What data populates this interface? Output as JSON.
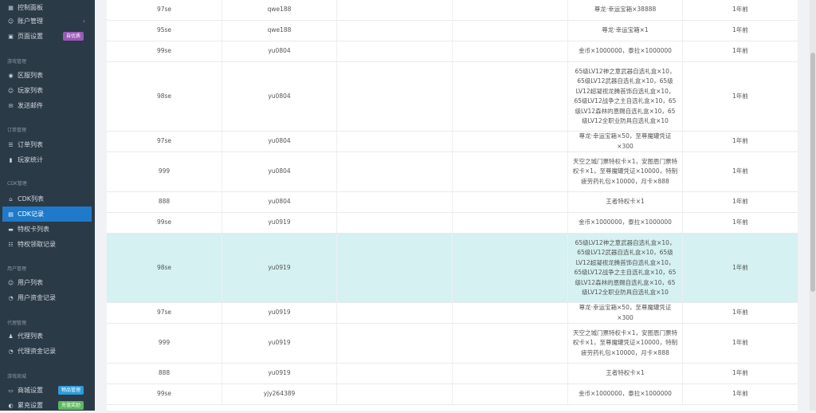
{
  "sidebar": {
    "items": [
      {
        "label": "控制面板",
        "icon": "dashboard-icon"
      },
      {
        "label": "账户管理",
        "icon": "user-settings-icon"
      },
      {
        "label": "页面设置",
        "icon": "page-settings-icon",
        "badge": "自优质",
        "badge_color": "#9b59b6"
      }
    ],
    "sections": [
      {
        "title": "游戏管理",
        "items": [
          {
            "label": "区服列表",
            "icon": "server-icon"
          },
          {
            "label": "玩家列表",
            "icon": "players-icon"
          },
          {
            "label": "发送邮件",
            "icon": "mail-icon"
          }
        ]
      },
      {
        "title": "订单管理",
        "items": [
          {
            "label": "订单列表",
            "icon": "order-list-icon"
          },
          {
            "label": "玩家统计",
            "icon": "bar-chart-icon"
          }
        ]
      },
      {
        "title": "CDK管理",
        "items": [
          {
            "label": "CDK列表",
            "icon": "cdk-list-icon"
          },
          {
            "label": "CDK记录",
            "icon": "cdk-record-icon",
            "active": true
          },
          {
            "label": "特权卡列表",
            "icon": "card-icon"
          },
          {
            "label": "特权领取记录",
            "icon": "record-icon"
          }
        ]
      },
      {
        "title": "用户管理",
        "items": [
          {
            "label": "用户列表",
            "icon": "user-list-icon"
          },
          {
            "label": "用户资金记录",
            "icon": "funds-icon"
          }
        ]
      },
      {
        "title": "代理管理",
        "items": [
          {
            "label": "代理列表",
            "icon": "agent-icon"
          },
          {
            "label": "代理资金记录",
            "icon": "agent-funds-icon"
          }
        ]
      },
      {
        "title": "游戏商城",
        "items": [
          {
            "label": "商城设置",
            "icon": "shop-icon",
            "badge": "物品管理",
            "badge_color": "#2d9cdb"
          },
          {
            "label": "累充设置",
            "icon": "recharge-icon",
            "badge": "充值奖励",
            "badge_color": "#5cb85c"
          }
        ]
      }
    ]
  },
  "table": {
    "rows": [
      {
        "server": "97se",
        "user": "qwe188",
        "c3": "",
        "c4": "",
        "reward": "尊龙·幸运宝箱×38888",
        "time": "1年前"
      },
      {
        "server": "95se",
        "user": "qwe188",
        "c3": "",
        "c4": "",
        "reward": "尊龙·幸运宝箱×1",
        "time": "1年前"
      },
      {
        "server": "99se",
        "user": "yu0804",
        "c3": "",
        "c4": "",
        "reward": "金币×1000000，泰拉×1000000",
        "time": "1年前"
      },
      {
        "server": "98se",
        "user": "yu0804",
        "c3": "",
        "c4": "",
        "reward": "65级LV12神之意武器自选礼盒×10，65级LV12武器自选礼盒×10，65级LV12超凝视龙腾首饰自选礼盒×10，65级LV12战争之主自选礼盒×10，65级LV12森林的恩赐自选礼盒×10，65级LV12全职业防具自选礼盒×10",
        "time": "1年前"
      },
      {
        "server": "97se",
        "user": "yu0804",
        "c3": "",
        "c4": "",
        "reward": "尊龙·幸运宝箱×50，至尊魔罐凭证×300",
        "time": "1年前"
      },
      {
        "server": "999",
        "user": "yu0804",
        "c3": "",
        "c4": "",
        "reward": "天空之城门票特权卡×1，安图恩门票特权卡×1，至尊魔罐凭证×10000，特制疲劳药礼包×10000，月卡×888",
        "time": "1年前"
      },
      {
        "server": "888",
        "user": "yu0804",
        "c3": "",
        "c4": "",
        "reward": "王者特权卡×1",
        "time": "1年前"
      },
      {
        "server": "99se",
        "user": "yu0919",
        "c3": "",
        "c4": "",
        "reward": "金币×1000000，泰拉×1000000",
        "time": "1年前"
      },
      {
        "server": "98se",
        "user": "yu0919",
        "c3": "",
        "c4": "",
        "reward": "65级LV12神之意武器自选礼盒×10，65级LV12武器自选礼盒×10，65级LV12超凝视龙腾首饰自选礼盒×10，65级LV12战争之主自选礼盒×10，65级LV12森林的恩赐自选礼盒×10，65级LV12全职业防具自选礼盒×10",
        "time": "1年前",
        "highlight": true
      },
      {
        "server": "97se",
        "user": "yu0919",
        "c3": "",
        "c4": "",
        "reward": "尊龙·幸运宝箱×50，至尊魔罐凭证×300",
        "time": "1年前"
      },
      {
        "server": "999",
        "user": "yu0919",
        "c3": "",
        "c4": "",
        "reward": "天空之城门票特权卡×1，安图恩门票特权卡×1，至尊魔罐凭证×10000，特制疲劳药礼包×10000，月卡×888",
        "time": "1年前"
      },
      {
        "server": "888",
        "user": "yu0919",
        "c3": "",
        "c4": "",
        "reward": "王者特权卡×1",
        "time": "1年前"
      },
      {
        "server": "99se",
        "user": "yjy264389",
        "c3": "",
        "c4": "",
        "reward": "金币×1000000，泰拉×1000000",
        "time": "1年前"
      }
    ]
  }
}
